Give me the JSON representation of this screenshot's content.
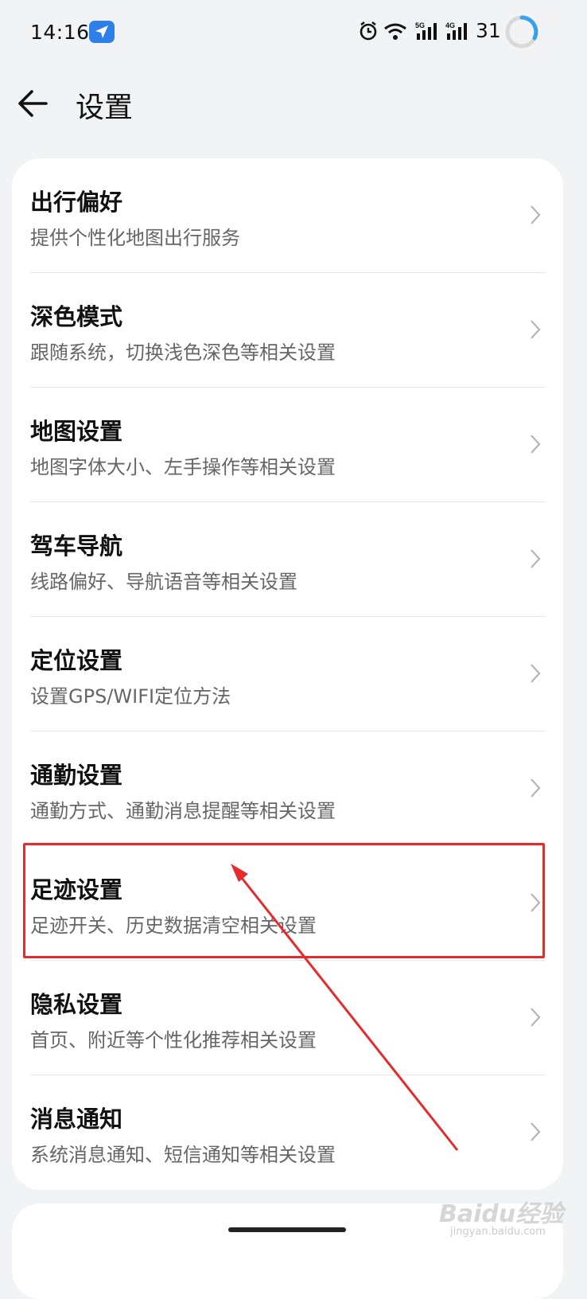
{
  "status_bar": {
    "time": "14:16",
    "battery": "31",
    "net1": "5G",
    "net2": "4G"
  },
  "header": {
    "title": "设置"
  },
  "settings": [
    {
      "title": "出行偏好",
      "subtitle": "提供个性化地图出行服务"
    },
    {
      "title": "深色模式",
      "subtitle": "跟随系统，切换浅色深色等相关设置"
    },
    {
      "title": "地图设置",
      "subtitle": "地图字体大小、左手操作等相关设置"
    },
    {
      "title": "驾车导航",
      "subtitle": "线路偏好、导航语音等相关设置"
    },
    {
      "title": "定位设置",
      "subtitle": "设置GPS/WIFI定位方法"
    },
    {
      "title": "通勤设置",
      "subtitle": "通勤方式、通勤消息提醒等相关设置"
    },
    {
      "title": "足迹设置",
      "subtitle": "足迹开关、历史数据清空相关设置"
    },
    {
      "title": "隐私设置",
      "subtitle": "首页、附近等个性化推荐相关设置"
    },
    {
      "title": "消息通知",
      "subtitle": "系统消息通知、短信通知等相关设置"
    }
  ],
  "colors": {
    "accent": "#2f7fe8",
    "highlight": "#e52b2b"
  },
  "watermark": {
    "brand": "Baidu经验",
    "url": "jingyan.baidu.com"
  }
}
